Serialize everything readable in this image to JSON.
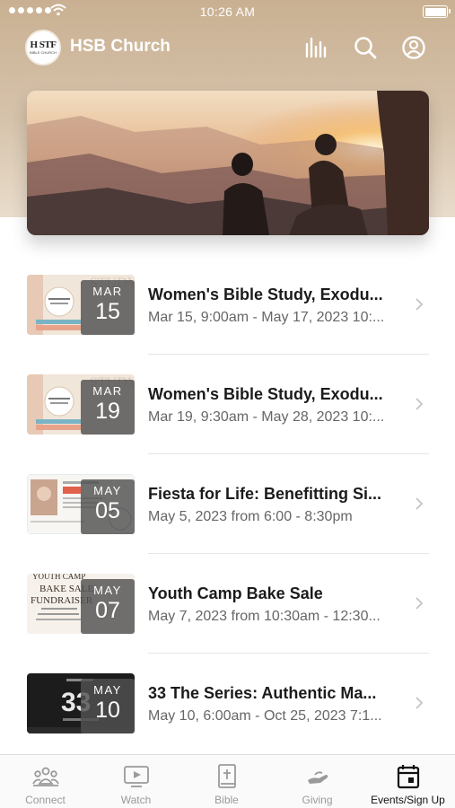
{
  "status_bar": {
    "time": "10:26 AM"
  },
  "app": {
    "logo_text": "H STF",
    "logo_subtext": "BIBLE CHURCH",
    "title": "HSB Church",
    "actions": [
      {
        "name": "audio-bars-icon",
        "label": "Audio"
      },
      {
        "name": "search-icon",
        "label": "Search"
      },
      {
        "name": "profile-icon",
        "label": "Profile"
      }
    ]
  },
  "events": [
    {
      "month": "MAR",
      "day": "15",
      "title": "Women's Bible Study, Exodu...",
      "subtitle": "Mar 15, 9:00am - May 17, 2023 10:...",
      "thumb": "bible-study"
    },
    {
      "month": "MAR",
      "day": "19",
      "title": "Women's Bible Study, Exodu...",
      "subtitle": "Mar 19, 9:30am - May 28, 2023 10:...",
      "thumb": "bible-study"
    },
    {
      "month": "MAY",
      "day": "05",
      "title": "Fiesta for Life: Benefitting Si...",
      "subtitle": "May 5, 2023 from 6:00 - 8:30pm",
      "thumb": "fiesta"
    },
    {
      "month": "MAY",
      "day": "07",
      "title": "Youth Camp Bake Sale",
      "subtitle": "May 7, 2023 from 10:30am - 12:30...",
      "thumb": "bake-sale"
    },
    {
      "month": "MAY",
      "day": "10",
      "title": "33 The Series: Authentic Ma...",
      "subtitle": "May 10, 6:00am - Oct 25, 2023 7:1...",
      "thumb": "series"
    }
  ],
  "tabs": [
    {
      "label": "Connect",
      "icon": "people-icon",
      "active": false
    },
    {
      "label": "Watch",
      "icon": "play-screen-icon",
      "active": false
    },
    {
      "label": "Bible",
      "icon": "bible-icon",
      "active": false
    },
    {
      "label": "Giving",
      "icon": "giving-hand-icon",
      "active": false
    },
    {
      "label": "Events/Sign Up",
      "icon": "calendar-icon",
      "active": true
    }
  ],
  "colors": {
    "header_bg": "#c9b092",
    "badge_bg": "#505050",
    "tab_inactive": "#9a9a9a",
    "tab_active": "#111111"
  }
}
